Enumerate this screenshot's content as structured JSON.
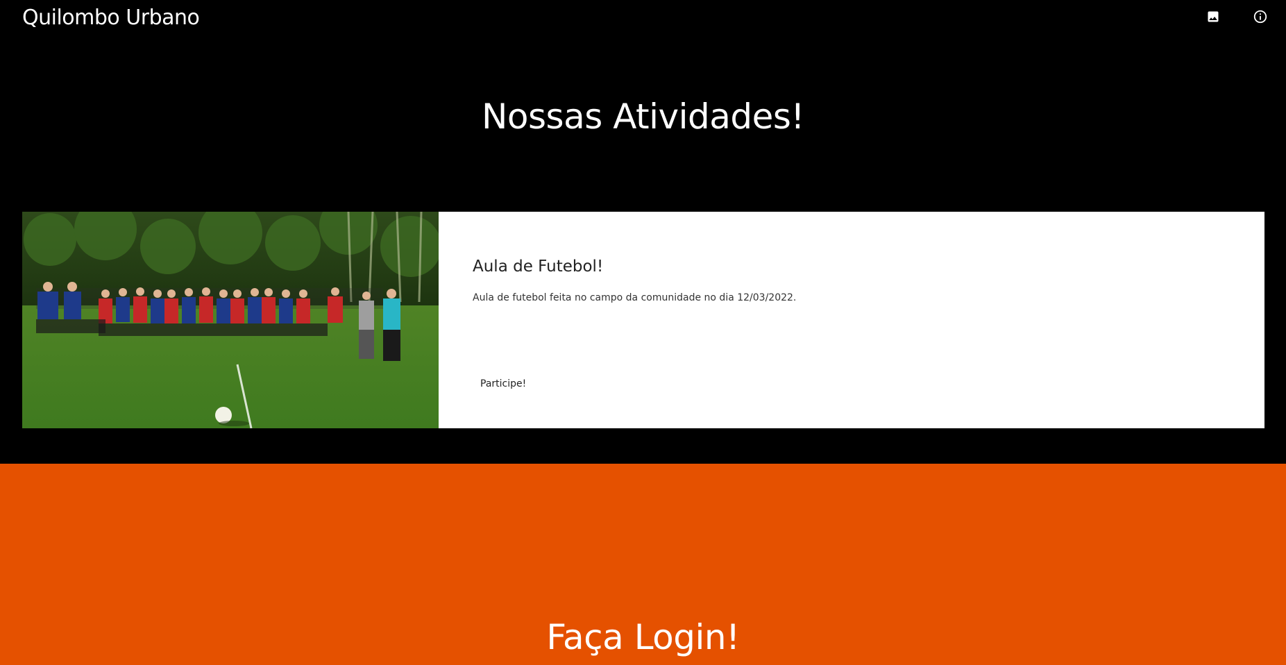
{
  "app": {
    "title": "Quilombo Urbano"
  },
  "toolbar": {
    "image_icon": "image-icon",
    "info_icon": "info-icon"
  },
  "activities": {
    "title": "Nossas Atividades!",
    "card": {
      "image_alt": "Foto do time de futebol no campo",
      "title": "Aula de Futebol!",
      "description": "Aula de futebol feita no campo da comunidade no dia 12/03/2022.",
      "button_label": "Participe!"
    }
  },
  "login": {
    "title": "Faça Login!"
  },
  "colors": {
    "background": "#000000",
    "login_background": "#e55100",
    "card_background": "#ffffff"
  }
}
